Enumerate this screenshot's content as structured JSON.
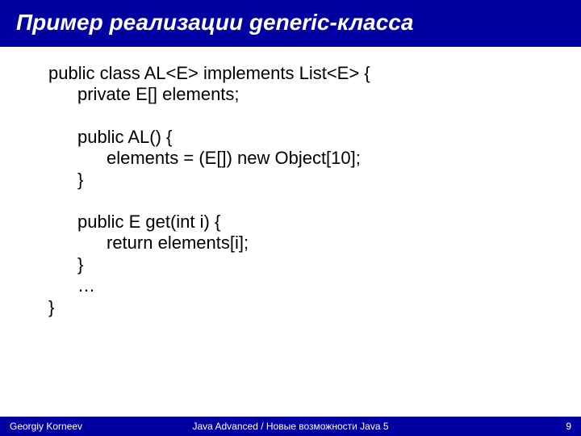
{
  "title": "Пример реализации generic-класса",
  "code": {
    "line1": "public class AL<E> implements List<E> {",
    "line2": "private E[] elements;",
    "line3": "public AL() {",
    "line4": "elements = (E[]) new Object[10];",
    "line5": "}",
    "line6": "public E get(int i) {",
    "line7": "return elements[i];",
    "line8": "}",
    "line9": "…",
    "line10": "}"
  },
  "footer": {
    "author": "Georgiy Korneev",
    "course": "Java Advanced / Новые возможности Java 5",
    "page": "9"
  }
}
